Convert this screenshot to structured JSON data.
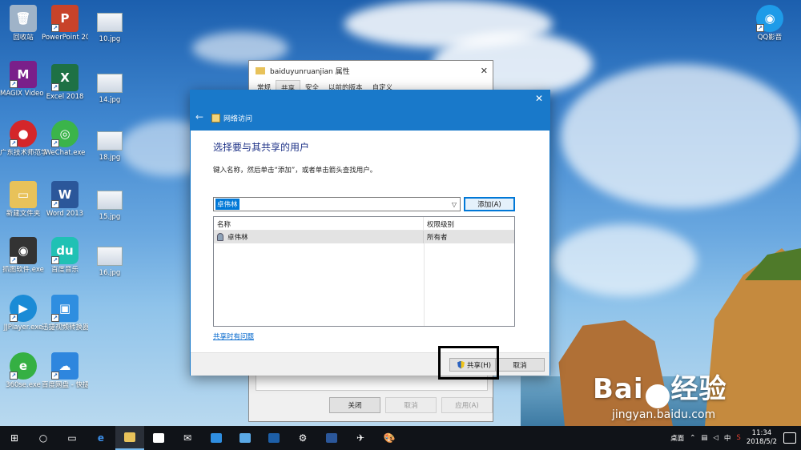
{
  "desktop_icons": [
    {
      "label": "回收站"
    },
    {
      "label": "PowerPoint 2013"
    },
    {
      "label": "10.jpg"
    },
    {
      "label": "MAGIX Video Pro X"
    },
    {
      "label": "Excel 2018"
    },
    {
      "label": "14.jpg"
    },
    {
      "label": "广东技术师范学院认..."
    },
    {
      "label": "WeChat.exe"
    },
    {
      "label": "18.jpg"
    },
    {
      "label": "新建文件夹"
    },
    {
      "label": "Word 2013"
    },
    {
      "label": "15.jpg"
    },
    {
      "label": "抓图软件.exe"
    },
    {
      "label": "百度音乐"
    },
    {
      "label": "16.jpg"
    },
    {
      "label": "JJPlayer.exe"
    },
    {
      "label": "迅捷视频转换器"
    },
    {
      "label": "360se.exe"
    },
    {
      "label": "百度网盘 - 快捷方式"
    },
    {
      "label": "QQ影音"
    }
  ],
  "props_window": {
    "title": "baiduyunruanjian 属性",
    "tabs": [
      "常规",
      "共享",
      "安全",
      "以前的版本",
      "自定义"
    ],
    "buttons": {
      "ok": "关闭",
      "cancel": "取消",
      "apply": "应用(A)"
    }
  },
  "dialog": {
    "title": "网络访问",
    "heading": "选择要与其共享的用户",
    "instruction": "键入名称，然后单击“添加”，或者单击箭头查找用户。",
    "combo_value": "卓伟林",
    "add_button": "添加(A)",
    "columns": [
      "名称",
      "权限级别"
    ],
    "rows": [
      {
        "name": "卓伟林",
        "level": "所有者"
      }
    ],
    "trouble_link": "共享时有问题",
    "share_button": "共享(H)",
    "cancel_button": "取消"
  },
  "watermark": {
    "brand": "Bai",
    "brand2": "经验",
    "url": "jingyan.baidu.com"
  },
  "taskbar": {
    "tray_desktop": "桌面",
    "ime": "中",
    "time": "11:34",
    "date": "2018/5/2"
  },
  "icons": [
    "windows-start-icon",
    "cortana-icon",
    "task-view-icon",
    "edge-icon",
    "file-explorer-icon",
    "store-icon",
    "mail-icon",
    "settings-icon",
    "word-icon",
    "shield-icon",
    "user-icon",
    "close-icon",
    "back-arrow-icon"
  ],
  "colors": {
    "accent": "#1979ca",
    "link": "#0066cc",
    "heading": "#1e3287"
  }
}
